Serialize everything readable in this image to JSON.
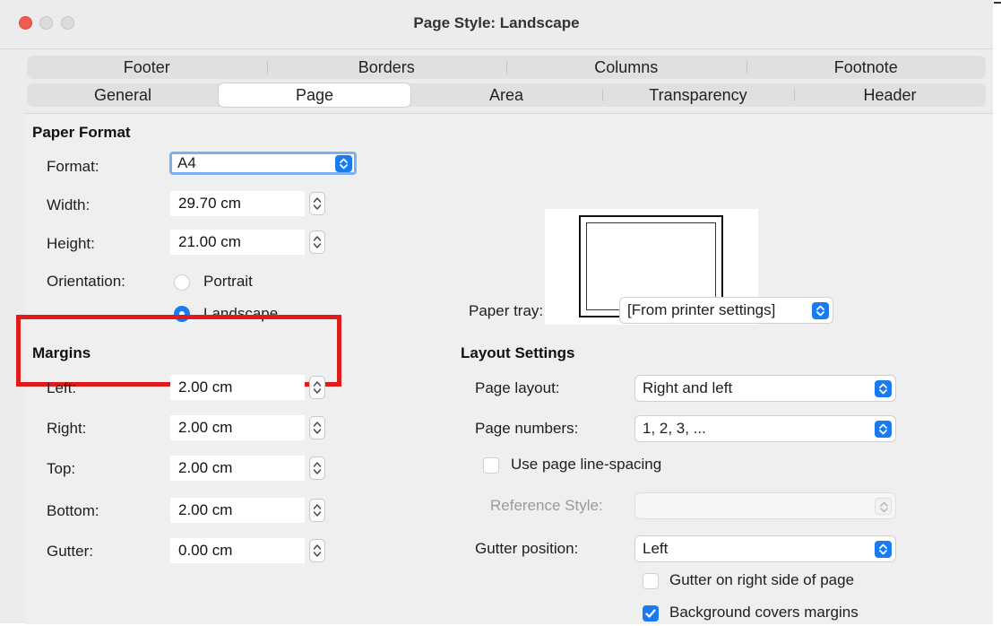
{
  "window": {
    "title": "Page Style: Landscape"
  },
  "tabs": {
    "row1": [
      "Footer",
      "Borders",
      "Columns",
      "Footnote"
    ],
    "row2": [
      "General",
      "Page",
      "Area",
      "Transparency",
      "Header"
    ],
    "active": "Page"
  },
  "paper_format": {
    "heading": "Paper Format",
    "format_label": "Format:",
    "format_value": "A4",
    "width_label": "Width:",
    "width_value": "29.70 cm",
    "height_label": "Height:",
    "height_value": "21.00 cm",
    "orientation_label": "Orientation:",
    "portrait_label": "Portrait",
    "landscape_label": "Landscape",
    "orientation_selected": "Landscape"
  },
  "paper_tray": {
    "label": "Paper tray:",
    "value": "[From printer settings]"
  },
  "margins": {
    "heading": "Margins",
    "left_label": "Left:",
    "left_value": "2.00 cm",
    "right_label": "Right:",
    "right_value": "2.00 cm",
    "top_label": "Top:",
    "top_value": "2.00 cm",
    "bottom_label": "Bottom:",
    "bottom_value": "2.00 cm",
    "gutter_label": "Gutter:",
    "gutter_value": "0.00 cm"
  },
  "layout_settings": {
    "heading": "Layout Settings",
    "page_layout_label": "Page layout:",
    "page_layout_value": "Right and left",
    "page_numbers_label": "Page numbers:",
    "page_numbers_value": "1, 2, 3, ...",
    "use_line_spacing_label": "Use page line-spacing",
    "use_line_spacing_checked": false,
    "reference_style_label": "Reference Style:",
    "reference_style_value": "",
    "gutter_position_label": "Gutter position:",
    "gutter_position_value": "Left",
    "gutter_right_label": "Gutter on right side of page",
    "gutter_right_checked": false,
    "bg_covers_label": "Background covers margins",
    "bg_covers_checked": true
  },
  "colors": {
    "accent": "#1a7af0",
    "highlight": "#e01b1b"
  }
}
